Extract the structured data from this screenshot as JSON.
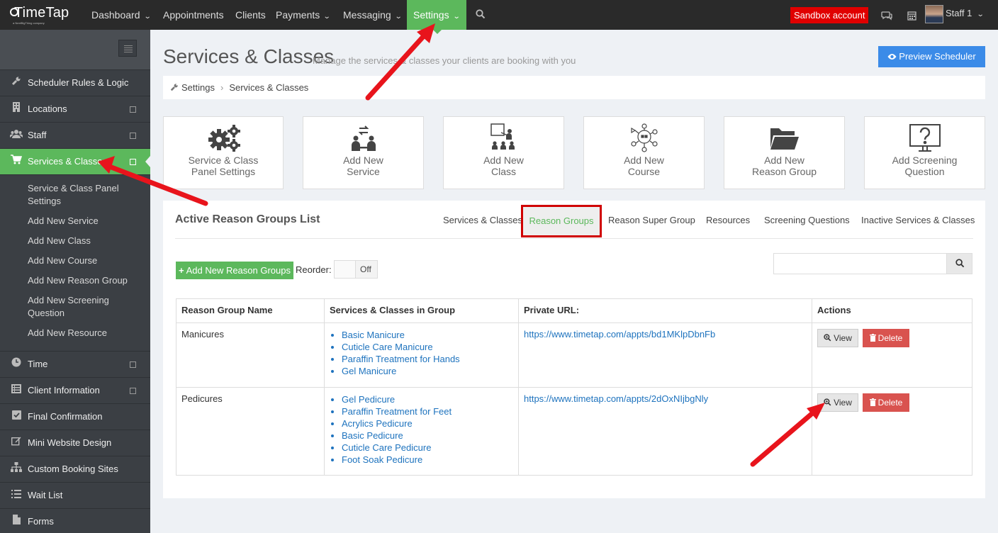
{
  "topnav": {
    "logo": "TimeTap",
    "logo_sub": "a NextBigThing company",
    "items": [
      "Dashboard",
      "Appointments",
      "Clients",
      "Payments",
      "Messaging",
      "Settings"
    ],
    "sandbox": "Sandbox account",
    "staff": "Staff 1"
  },
  "sidebar": {
    "items": [
      {
        "label": "Scheduler Rules & Logic",
        "icon": "wrench-icon"
      },
      {
        "label": "Locations",
        "icon": "building-icon"
      },
      {
        "label": "Staff",
        "icon": "users-icon"
      },
      {
        "label": "Services & Classes",
        "icon": "cart-icon"
      },
      {
        "label": "Time",
        "icon": "clock-icon"
      },
      {
        "label": "Client Information",
        "icon": "list-icon"
      },
      {
        "label": "Final Confirmation",
        "icon": "check-icon"
      },
      {
        "label": "Mini Website Design",
        "icon": "edit-icon"
      },
      {
        "label": "Custom Booking Sites",
        "icon": "sitemap-icon"
      },
      {
        "label": "Wait List",
        "icon": "list-icon"
      },
      {
        "label": "Forms",
        "icon": "file-icon"
      }
    ],
    "subitems": [
      "Service & Class Panel Settings",
      "Add New Service",
      "Add New Class",
      "Add New Course",
      "Add New Reason Group",
      "Add New Screening Question",
      "Add New Resource"
    ]
  },
  "page": {
    "title": "Services & Classes",
    "subtitle": "Manage the services & classes your clients are booking with you",
    "preview_button": "Preview Scheduler",
    "breadcrumb": [
      "Settings",
      "Services & Classes"
    ]
  },
  "tiles": [
    {
      "line1": "Service & Class",
      "line2": "Panel Settings",
      "icon": "gears-icon"
    },
    {
      "line1": "Add New",
      "line2": "Service",
      "icon": "service-icon"
    },
    {
      "line1": "Add New",
      "line2": "Class",
      "icon": "class-icon"
    },
    {
      "line1": "Add New",
      "line2": "Course",
      "icon": "course-icon"
    },
    {
      "line1": "Add New",
      "line2": "Reason Group",
      "icon": "folder-icon"
    },
    {
      "line1": "Add Screening",
      "line2": "Question",
      "icon": "question-icon"
    }
  ],
  "panel": {
    "title": "Active Reason Groups List",
    "tabs": [
      "Services & Classes",
      "Reason Groups",
      "Reason Super Group",
      "Resources",
      "Screening Questions",
      "Inactive Services & Classes"
    ],
    "add_button": "Add New Reason Groups",
    "reorder_label": "Reorder:",
    "toggle_state": "Off",
    "search_placeholder": ""
  },
  "table": {
    "headers": [
      "Reason Group Name",
      "Services & Classes in Group",
      "Private URL:",
      "Actions"
    ],
    "view_label": "View",
    "delete_label": "Delete",
    "rows": [
      {
        "name": "Manicures",
        "services": [
          "Basic Manicure",
          "Cuticle Care Manicure",
          "Paraffin Treatment for Hands",
          "Gel Manicure"
        ],
        "url": "https://www.timetap.com/appts/bd1MKlpDbnFb"
      },
      {
        "name": "Pedicures",
        "services": [
          "Gel Pedicure",
          "Paraffin Treatment for Feet",
          "Acrylics Pedicure",
          "Basic Pedicure",
          "Cuticle Care Pedicure",
          "Foot Soak Pedicure"
        ],
        "url": "https://www.timetap.com/appts/2dOxNIjbgNly"
      }
    ]
  },
  "colors": {
    "accent_green": "#5cb85c",
    "primary_blue": "#3b8be8",
    "danger_red": "#d9534f",
    "annotation_red": "#e8141c"
  }
}
